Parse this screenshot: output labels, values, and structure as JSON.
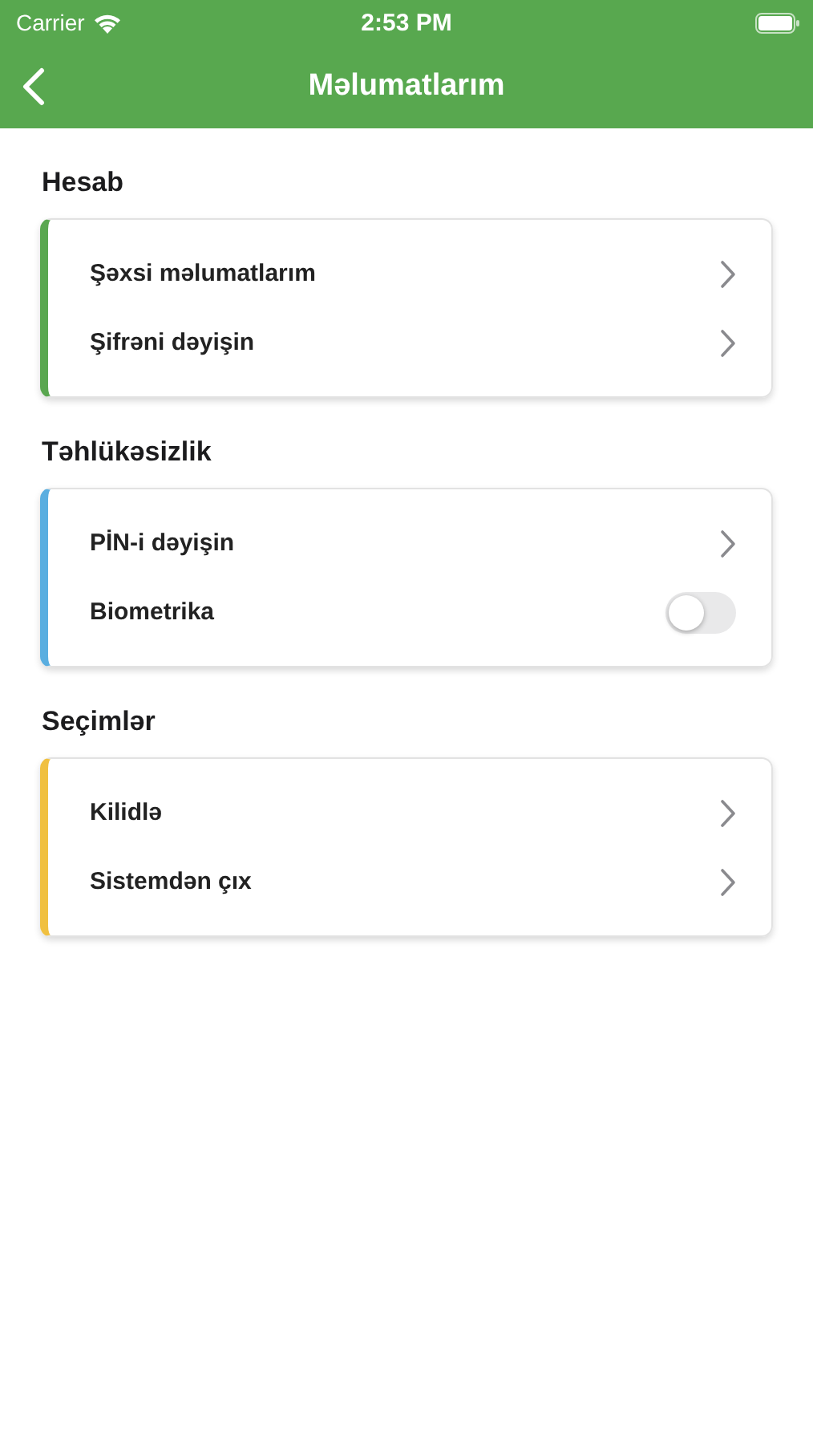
{
  "status_bar": {
    "carrier": "Carrier",
    "time": "2:53 PM"
  },
  "nav_bar": {
    "title": "Məlumatlarım"
  },
  "sections": [
    {
      "title": "Hesab",
      "color": "#5aa750",
      "rows": [
        {
          "kind": "link",
          "label": "Şəxsi məlumatlarım"
        },
        {
          "kind": "link",
          "label": "Şifrəni dəyişin"
        }
      ]
    },
    {
      "title": "Təhlükəsizlik",
      "color": "#5aaee0",
      "rows": [
        {
          "kind": "link",
          "label": "PİN-i dəyişin"
        },
        {
          "kind": "toggle",
          "label": "Biometrika",
          "on": false
        }
      ]
    },
    {
      "title": "Seçimlər",
      "color": "#f0c040",
      "rows": [
        {
          "kind": "link",
          "label": "Kilidlə"
        },
        {
          "kind": "link",
          "label": "Sistemdən çıx"
        }
      ]
    }
  ]
}
